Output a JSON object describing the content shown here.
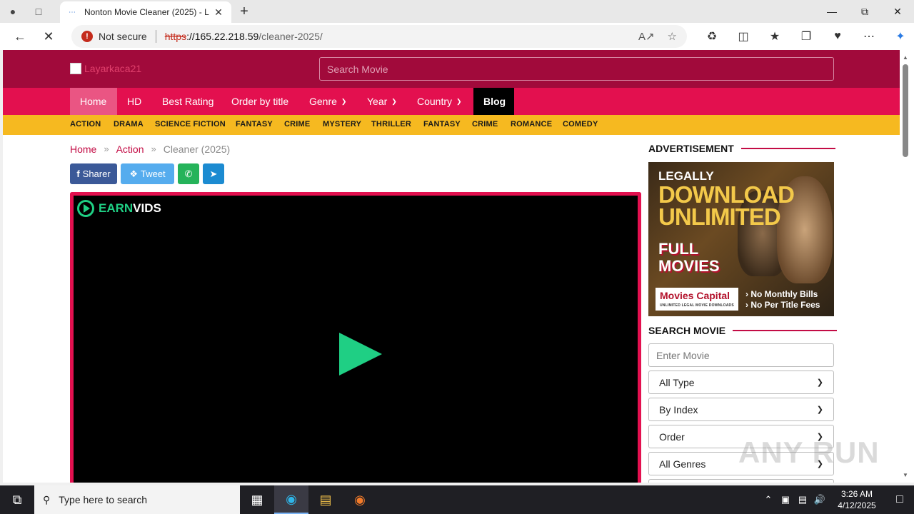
{
  "browser": {
    "tab_title": "Nonton Movie Cleaner (2025) - L",
    "not_secure": "Not secure",
    "url_scheme": "https",
    "url_host": "://165.22.218.59",
    "url_path": "/cleaner-2025/"
  },
  "site": {
    "logo_alt": "Layarkaca21",
    "search_placeholder": "Search Movie",
    "nav": [
      {
        "label": "Home"
      },
      {
        "label": "HD"
      },
      {
        "label": "Best Rating"
      },
      {
        "label": "Order by title"
      },
      {
        "label": "Genre"
      },
      {
        "label": "Year"
      },
      {
        "label": "Country"
      },
      {
        "label": "Blog"
      }
    ],
    "genres": [
      "ACTION",
      "DRAMA",
      "SCIENCE FICTION",
      "FANTASY",
      "CRIME",
      "MYSTERY",
      "THRILLER",
      "FANTASY",
      "CRIME",
      "ROMANCE",
      "COMEDY"
    ]
  },
  "breadcrumb": {
    "home": "Home",
    "category": "Action",
    "current": "Cleaner (2025)",
    "separator": "»"
  },
  "share": {
    "facebook": "Sharer",
    "twitter": "Tweet",
    "colors": {
      "facebook": "#3b5998",
      "twitter": "#55acee",
      "whatsapp": "#25b35a",
      "telegram": "#1c8bd1"
    }
  },
  "player": {
    "brand_earn": "EARN",
    "brand_vids": "VIDS",
    "accent": "#1fcf84"
  },
  "sidebar": {
    "ad_title": "ADVERTISEMENT",
    "ad": {
      "line1": "LEGALLY",
      "line2": "DOWNLOAD",
      "line3": "UNLIMITED",
      "line4": "FULL",
      "line5": "MOVIES",
      "brand": "Movies Capital",
      "brand_sub": "UNLIMITED LEGAL MOVIE DOWNLOADS",
      "fee1": "› No Monthly Bills",
      "fee2": "› No Per Title Fees"
    },
    "search_title": "SEARCH MOVIE",
    "search_placeholder": "Enter Movie",
    "selects": [
      "All Type",
      "By Index",
      "Order",
      "All Genres"
    ]
  },
  "watermark": "ANY RUN",
  "taskbar": {
    "search_placeholder": "Type here to search",
    "time": "3:26 AM",
    "date": "4/12/2025"
  },
  "colors": {
    "header": "#a10a3b",
    "nav": "#e3104f",
    "genre_bar": "#f6b920"
  }
}
